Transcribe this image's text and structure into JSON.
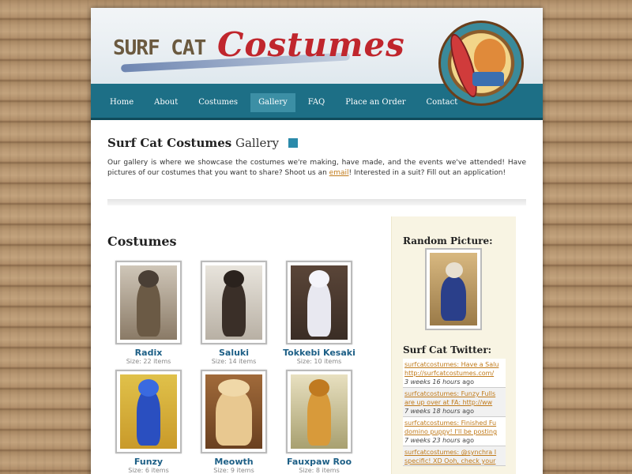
{
  "site": {
    "logo_text_1": "SURF CAT",
    "logo_text_2": "Costumes"
  },
  "nav": {
    "items": [
      {
        "label": "Home"
      },
      {
        "label": "About"
      },
      {
        "label": "Costumes"
      },
      {
        "label": "Gallery",
        "active": true
      },
      {
        "label": "FAQ"
      },
      {
        "label": "Place an Order"
      },
      {
        "label": "Contact"
      }
    ]
  },
  "page": {
    "title_bold": "Surf Cat Costumes",
    "title_rest": "Gallery",
    "intro_before_link": "Our gallery is where we showcase the costumes we're making, have made, and the events we've attended! Have pictures of our costumes that you want to share? Shoot us an ",
    "intro_link": "email",
    "intro_after_link": "! Interested in a suit? Fill out an application!",
    "costumes_heading": "Costumes"
  },
  "costumes": [
    {
      "name": "Radix",
      "size": "Size: 22 items"
    },
    {
      "name": "Saluki",
      "size": "Size: 14 items"
    },
    {
      "name": "Tokkebi Kesaki",
      "size": "Size: 10 items"
    },
    {
      "name": "Funzy",
      "size": "Size: 6 items"
    },
    {
      "name": "Meowth",
      "size": "Size: 9 items"
    },
    {
      "name": "Fauxpaw Roo",
      "size": "Size: 8 items"
    }
  ],
  "sidebar": {
    "random_heading": "Random Picture:",
    "twitter_heading": "Surf Cat Twitter:",
    "tweets": [
      {
        "text_1": "surfcatcostumes: Have a Salu",
        "text_2": "http://surfcatcostumes.com/",
        "time_italic": "3 weeks 16 hours",
        "time_suffix": " ago"
      },
      {
        "text_1": "surfcatcostumes: Funzy Fulls",
        "text_2": "are up over at FA: http://ww",
        "time_italic": "7 weeks 18 hours",
        "time_suffix": " ago"
      },
      {
        "text_1": "surfcatcostumes: Finished Fu",
        "text_2": "domino puppy! I'll be posting",
        "time_italic": "7 weeks 23 hours",
        "time_suffix": " ago"
      },
      {
        "text_1": "surfcatcostumes: @synchra I",
        "text_2": "specific! XD Ooh, check your",
        "time_italic": "",
        "time_suffix": ""
      }
    ]
  },
  "colors": {
    "nav_bg": "#1d6f86",
    "nav_active": "#3c8fa5",
    "link_blue": "#1d5f86",
    "link_orange": "#c07a1a",
    "logo_red": "#c0262d"
  }
}
